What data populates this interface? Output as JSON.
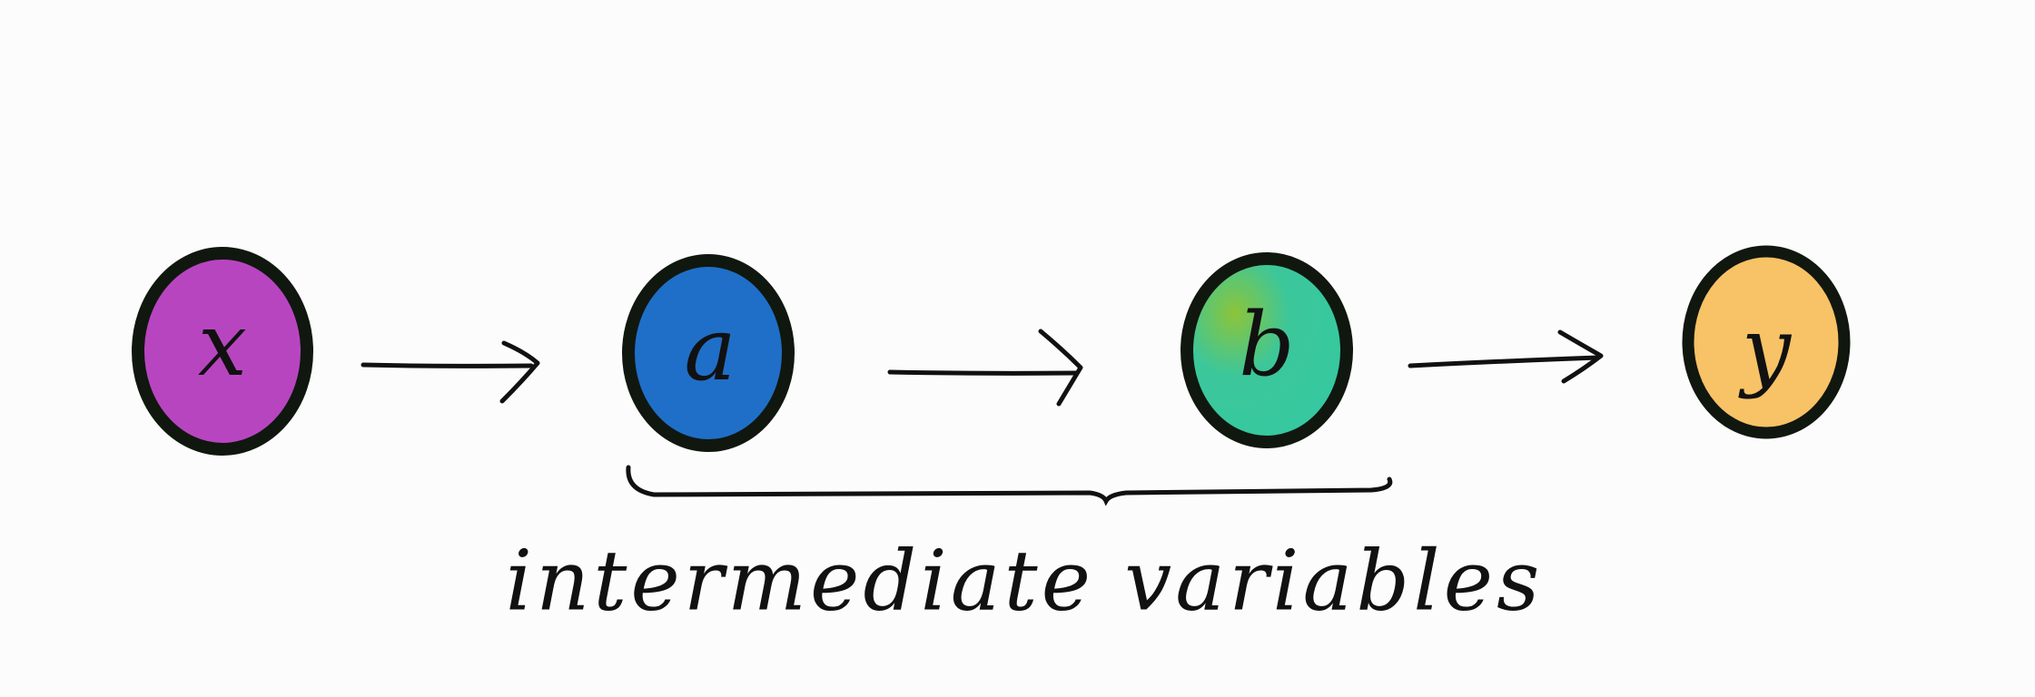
{
  "diagram": {
    "nodes": [
      {
        "id": "x",
        "label": "x",
        "fill": "#b845c0",
        "stroke": "#10170f"
      },
      {
        "id": "a",
        "label": "a",
        "fill": "#1f6fc8",
        "stroke": "#10170f"
      },
      {
        "id": "b",
        "label": "b",
        "fill": "#3cc79a",
        "stroke": "#10170f"
      },
      {
        "id": "y",
        "label": "y",
        "fill": "#f8c266",
        "stroke": "#10170f"
      }
    ],
    "edges": [
      {
        "from": "x",
        "to": "a"
      },
      {
        "from": "a",
        "to": "b"
      },
      {
        "from": "b",
        "to": "y"
      }
    ],
    "group": {
      "members": [
        "a",
        "b"
      ],
      "label": "intermediate variables"
    }
  }
}
